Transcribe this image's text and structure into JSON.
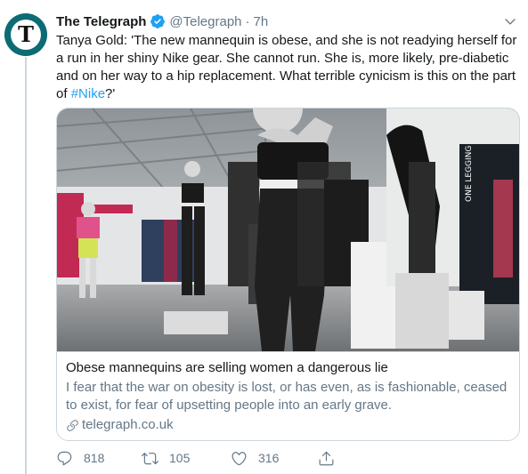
{
  "tweet": {
    "display_name": "The Telegraph",
    "handle": "@Telegraph",
    "separator": "·",
    "time": "7h",
    "text_before": "Tanya Gold: 'The new mannequin is obese, and she is not readying herself for a run in her shiny Nike gear. She cannot run. She is, more likely, pre-diabetic and on her way to a hip replacement. What terrible cynicism is this on the part of ",
    "hashtag": "#Nike",
    "text_after": "?'",
    "avatar_letter": "T"
  },
  "card": {
    "title": "Obese mannequins are selling women a dangerous lie",
    "description": "I fear that the war on obesity is lost, or has even, as is fashionable, ceased to exist, for fear of upsetting people into an early grave.",
    "domain": "telegraph.co.uk",
    "image_wall_text": "ONE LEGGING"
  },
  "actions": {
    "replies": "818",
    "retweets": "105",
    "likes": "316"
  },
  "colors": {
    "accent": "#1da1f2",
    "secondary_text": "#657786",
    "border": "#ccd6dd",
    "avatar_bg": "#0d6b74"
  },
  "icons": [
    "verified-badge-icon",
    "chevron-down-icon",
    "link-icon",
    "reply-icon",
    "retweet-icon",
    "like-icon",
    "share-icon"
  ]
}
